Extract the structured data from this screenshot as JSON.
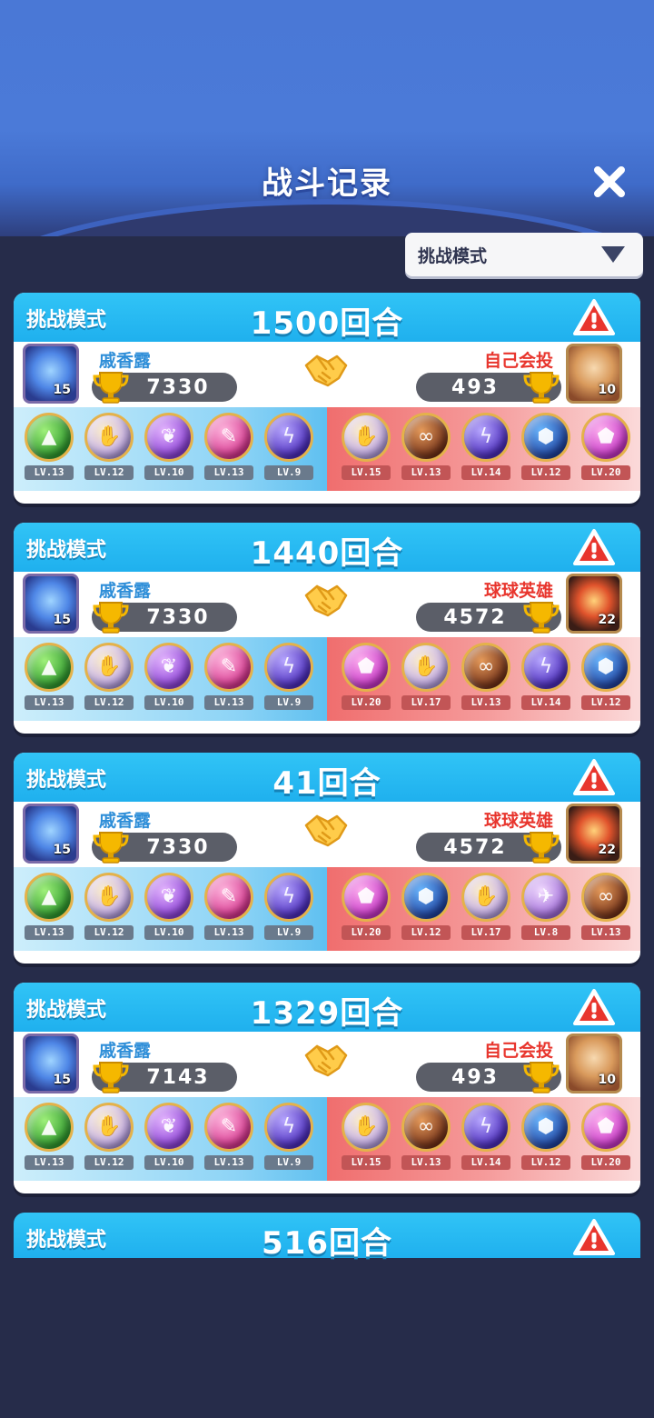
{
  "title": "战斗记录",
  "filter": {
    "selected": "挑战模式"
  },
  "records": [
    {
      "mode": "挑战模式",
      "rounds": "1500回合",
      "left": {
        "name": "戚香露",
        "score": "7330",
        "level": "15"
      },
      "right": {
        "name": "自己会投",
        "score": "493",
        "level": "10",
        "avatar": "face"
      },
      "left_balls": [
        {
          "color": "g-green",
          "glyph": "▲",
          "lv": "LV.13"
        },
        {
          "color": "g-gold",
          "glyph": "✋",
          "lv": "LV.12"
        },
        {
          "color": "g-purple",
          "glyph": "❦",
          "lv": "LV.10"
        },
        {
          "color": "g-pink",
          "glyph": "✎",
          "lv": "LV.13"
        },
        {
          "color": "g-violet",
          "glyph": "ϟ",
          "lv": "LV.9"
        }
      ],
      "right_balls": [
        {
          "color": "g-gold",
          "glyph": "✋",
          "lv": "LV.15"
        },
        {
          "color": "g-brown",
          "glyph": "∞",
          "lv": "LV.13"
        },
        {
          "color": "g-violet",
          "glyph": "ϟ",
          "lv": "LV.14"
        },
        {
          "color": "g-blue",
          "glyph": "⬢",
          "lv": "LV.12"
        },
        {
          "color": "g-magenta",
          "glyph": "⬟",
          "lv": "LV.20"
        }
      ]
    },
    {
      "mode": "挑战模式",
      "rounds": "1440回合",
      "left": {
        "name": "戚香露",
        "score": "7330",
        "level": "15"
      },
      "right": {
        "name": "球球英雄",
        "score": "4572",
        "level": "22",
        "avatar": "red"
      },
      "left_balls": [
        {
          "color": "g-green",
          "glyph": "▲",
          "lv": "LV.13"
        },
        {
          "color": "g-gold",
          "glyph": "✋",
          "lv": "LV.12"
        },
        {
          "color": "g-purple",
          "glyph": "❦",
          "lv": "LV.10"
        },
        {
          "color": "g-pink",
          "glyph": "✎",
          "lv": "LV.13"
        },
        {
          "color": "g-violet",
          "glyph": "ϟ",
          "lv": "LV.9"
        }
      ],
      "right_balls": [
        {
          "color": "g-magenta",
          "glyph": "⬟",
          "lv": "LV.20"
        },
        {
          "color": "g-gold",
          "glyph": "✋",
          "lv": "LV.17"
        },
        {
          "color": "g-brown",
          "glyph": "∞",
          "lv": "LV.13"
        },
        {
          "color": "g-violet",
          "glyph": "ϟ",
          "lv": "LV.14"
        },
        {
          "color": "g-blue",
          "glyph": "⬢",
          "lv": "LV.12"
        }
      ]
    },
    {
      "mode": "挑战模式",
      "rounds": "41回合",
      "left": {
        "name": "戚香露",
        "score": "7330",
        "level": "15"
      },
      "right": {
        "name": "球球英雄",
        "score": "4572",
        "level": "22",
        "avatar": "red"
      },
      "left_balls": [
        {
          "color": "g-green",
          "glyph": "▲",
          "lv": "LV.13"
        },
        {
          "color": "g-gold",
          "glyph": "✋",
          "lv": "LV.12"
        },
        {
          "color": "g-purple",
          "glyph": "❦",
          "lv": "LV.10"
        },
        {
          "color": "g-pink",
          "glyph": "✎",
          "lv": "LV.13"
        },
        {
          "color": "g-violet",
          "glyph": "ϟ",
          "lv": "LV.9"
        }
      ],
      "right_balls": [
        {
          "color": "g-magenta",
          "glyph": "⬟",
          "lv": "LV.20"
        },
        {
          "color": "g-blue",
          "glyph": "⬢",
          "lv": "LV.12"
        },
        {
          "color": "g-gold",
          "glyph": "✋",
          "lv": "LV.17"
        },
        {
          "color": "g-lilac",
          "glyph": "✈",
          "lv": "LV.8"
        },
        {
          "color": "g-brown",
          "glyph": "∞",
          "lv": "LV.13"
        }
      ]
    },
    {
      "mode": "挑战模式",
      "rounds": "1329回合",
      "left": {
        "name": "戚香露",
        "score": "7143",
        "level": "15"
      },
      "right": {
        "name": "自己会投",
        "score": "493",
        "level": "10",
        "avatar": "face"
      },
      "left_balls": [
        {
          "color": "g-green",
          "glyph": "▲",
          "lv": "LV.13"
        },
        {
          "color": "g-gold",
          "glyph": "✋",
          "lv": "LV.12"
        },
        {
          "color": "g-purple",
          "glyph": "❦",
          "lv": "LV.10"
        },
        {
          "color": "g-pink",
          "glyph": "✎",
          "lv": "LV.13"
        },
        {
          "color": "g-violet",
          "glyph": "ϟ",
          "lv": "LV.9"
        }
      ],
      "right_balls": [
        {
          "color": "g-gold",
          "glyph": "✋",
          "lv": "LV.15"
        },
        {
          "color": "g-brown",
          "glyph": "∞",
          "lv": "LV.13"
        },
        {
          "color": "g-violet",
          "glyph": "ϟ",
          "lv": "LV.14"
        },
        {
          "color": "g-blue",
          "glyph": "⬢",
          "lv": "LV.12"
        },
        {
          "color": "g-magenta",
          "glyph": "⬟",
          "lv": "LV.20"
        }
      ]
    }
  ],
  "partial_record": {
    "mode": "挑战模式",
    "rounds": "516回合"
  },
  "colors": {
    "header_blue": "#1fb0ee",
    "left_name": "#2e8ed8",
    "right_name": "#e8352d",
    "warn_red": "#e8352d"
  }
}
